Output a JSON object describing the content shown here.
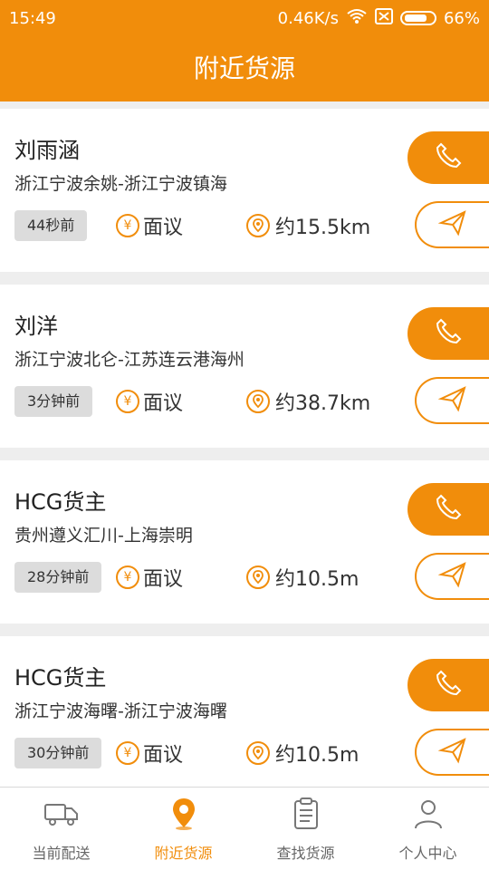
{
  "status": {
    "time": "15:49",
    "network": "0.46K/s",
    "battery": "66%"
  },
  "header": {
    "title": "附近货源"
  },
  "colors": {
    "accent": "#f18d0b",
    "badge_bg": "#dcdcdc",
    "text": "#222222"
  },
  "cards": [
    {
      "name": "刘雨涵",
      "route": "浙江宁波余姚-浙江宁波镇海",
      "time": "44秒前",
      "price": "面议",
      "distance": "约15.5km"
    },
    {
      "name": "刘洋",
      "route": "浙江宁波北仑-江苏连云港海州",
      "time": "3分钟前",
      "price": "面议",
      "distance": "约38.7km"
    },
    {
      "name": "HCG货主",
      "route": "贵州遵义汇川-上海崇明",
      "time": "28分钟前",
      "price": "面议",
      "distance": "约10.5m"
    },
    {
      "name": "HCG货主",
      "route": "浙江宁波海曙-浙江宁波海曙",
      "time": "30分钟前",
      "price": "面议",
      "distance": "约10.5m"
    }
  ],
  "tabbar": {
    "items": [
      {
        "label": "当前配送",
        "icon": "truck-icon",
        "active": false
      },
      {
        "label": "附近货源",
        "icon": "location-pin-icon",
        "active": true
      },
      {
        "label": "查找货源",
        "icon": "clipboard-icon",
        "active": false
      },
      {
        "label": "个人中心",
        "icon": "user-icon",
        "active": false
      }
    ]
  }
}
